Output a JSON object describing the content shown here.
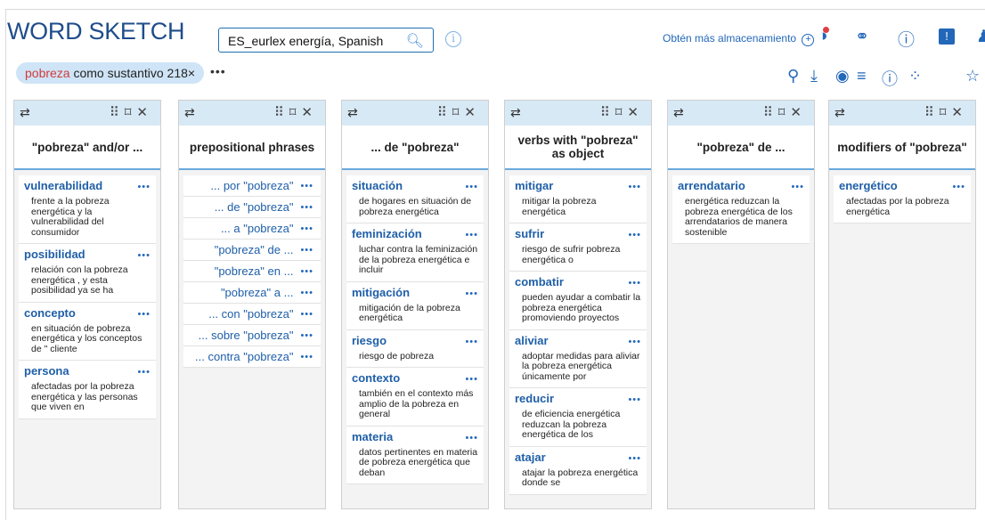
{
  "header": {
    "title": "WORD SKETCH",
    "corpus_value": "ES_eurlex energía, Spanish",
    "storage_label": "Obtén más almacenamiento",
    "storage_plus": "+"
  },
  "query": {
    "lemma": "pobreza",
    "rest": " como sustantivo 218×",
    "more": "•••"
  },
  "icons": {
    "search": "search-icon",
    "info": "info-icon",
    "link": "link-icon",
    "help": "help-icon",
    "feedback": "feedback-icon",
    "user": "user-icon",
    "zoom": "zoom-icon",
    "download": "download-icon",
    "view": "eye-icon",
    "filter": "filter-icon",
    "clusters": "clusters-icon",
    "star": "star-icon"
  },
  "columns": [
    {
      "title": "\"pobreza\" and/or ...",
      "items": [
        {
          "word": "vulnerabilidad",
          "example": "frente a la pobreza energética y la vulnerabilidad del consumidor"
        },
        {
          "word": "posibilidad",
          "example": "relación con la pobreza energética , y esta posibilidad ya se ha"
        },
        {
          "word": "concepto",
          "example": "en situación de pobreza energética y los conceptos de \" cliente"
        },
        {
          "word": "persona",
          "example": "afectadas por la pobreza energética y las personas que viven en"
        }
      ]
    },
    {
      "title": "prepositional phrases",
      "phrases": [
        "... por \"pobreza\"",
        "... de \"pobreza\"",
        "... a \"pobreza\"",
        "\"pobreza\" de ...",
        "\"pobreza\" en ...",
        "\"pobreza\" a ...",
        "... con \"pobreza\"",
        "... sobre \"pobreza\"",
        "... contra \"pobreza\""
      ]
    },
    {
      "title": "... de \"pobreza\"",
      "items": [
        {
          "word": "situación",
          "example": "de hogares en situación de pobreza energética"
        },
        {
          "word": "feminización",
          "example": "luchar contra la feminización de la pobreza energética e incluir"
        },
        {
          "word": "mitigación",
          "example": "mitigación de la pobreza energética"
        },
        {
          "word": "riesgo",
          "example": "riesgo de pobreza"
        },
        {
          "word": "contexto",
          "example": "también en el contexto más amplio de la pobreza en general"
        },
        {
          "word": "materia",
          "example": "datos pertinentes en materia de pobreza energética que deban"
        }
      ]
    },
    {
      "title": "verbs with \"pobreza\" as object",
      "items": [
        {
          "word": "mitigar",
          "example": "mitigar la pobreza energética"
        },
        {
          "word": "sufrir",
          "example": "riesgo de sufrir pobreza energética o"
        },
        {
          "word": "combatir",
          "example": "pueden ayudar a combatir la pobreza energética promoviendo proyectos"
        },
        {
          "word": "aliviar",
          "example": "adoptar medidas para aliviar la pobreza energética únicamente por"
        },
        {
          "word": "reducir",
          "example": "de eficiencia energética reduzcan la pobreza energética de los"
        },
        {
          "word": "atajar",
          "example": "atajar la pobreza energética donde se"
        }
      ]
    },
    {
      "title": "\"pobreza\" de ...",
      "items": [
        {
          "word": "arrendatario",
          "example": "energética reduzcan la pobreza energética de los arrendatarios de manera sostenible"
        }
      ]
    },
    {
      "title": "modifiers of \"pobreza\"",
      "items": [
        {
          "word": "energético",
          "example": "afectadas por la pobreza energética"
        }
      ]
    }
  ],
  "ui": {
    "swap": "⇄",
    "tools": "⠿⌑✕",
    "more": "•••"
  }
}
